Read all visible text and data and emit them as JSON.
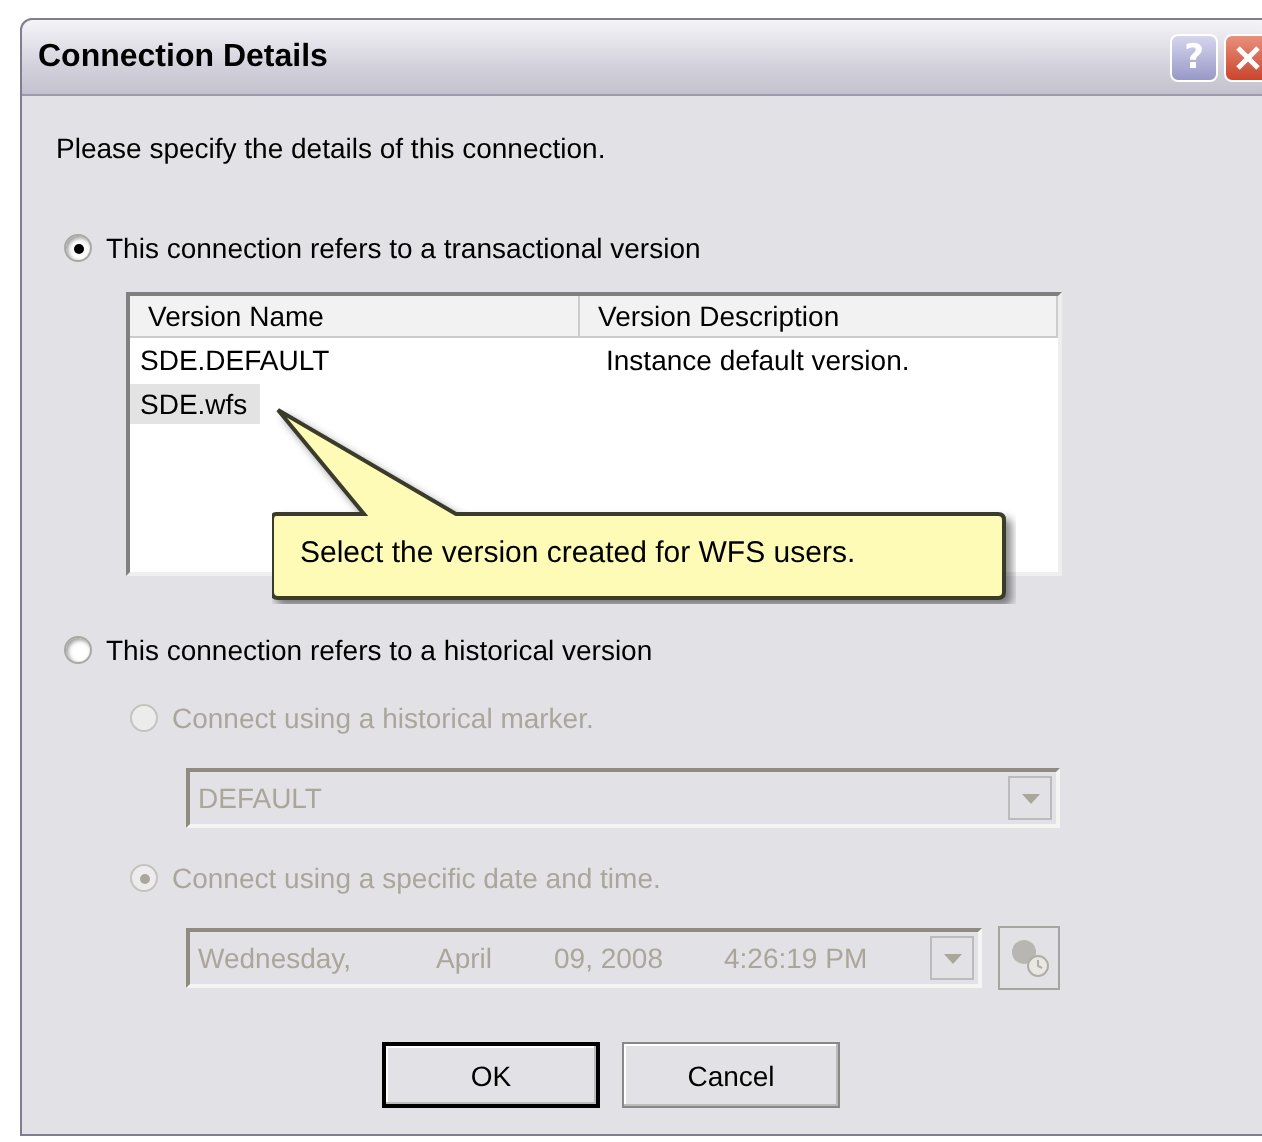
{
  "window": {
    "title": "Connection Details",
    "help_button": "?"
  },
  "intro": "Please specify the details of this connection.",
  "options": [
    {
      "label": "This connection refers to a transactional version",
      "selected": true
    },
    {
      "label": "This connection refers to a historical version",
      "selected": false
    }
  ],
  "version_list": {
    "columns": [
      "Version Name",
      "Version Description"
    ],
    "rows": [
      {
        "cells": [
          "SDE.DEFAULT",
          "Instance default version."
        ],
        "selected": false
      },
      {
        "cells": [
          "SDE.wfs"
        ],
        "selected": true
      }
    ]
  },
  "callout": "Select the version created for WFS users.",
  "historical": {
    "disabled": true,
    "modes": [
      {
        "label": "Connect using a historical marker.",
        "selected": false
      },
      {
        "label": "Connect using a specific date and time.",
        "selected": true
      }
    ],
    "marker": {
      "value": "DEFAULT"
    },
    "datetime": {
      "parts": [
        "Wednesday,",
        "April",
        "09, 2008",
        "4:26:19 PM"
      ]
    }
  },
  "buttons": [
    "OK",
    "Cancel"
  ]
}
